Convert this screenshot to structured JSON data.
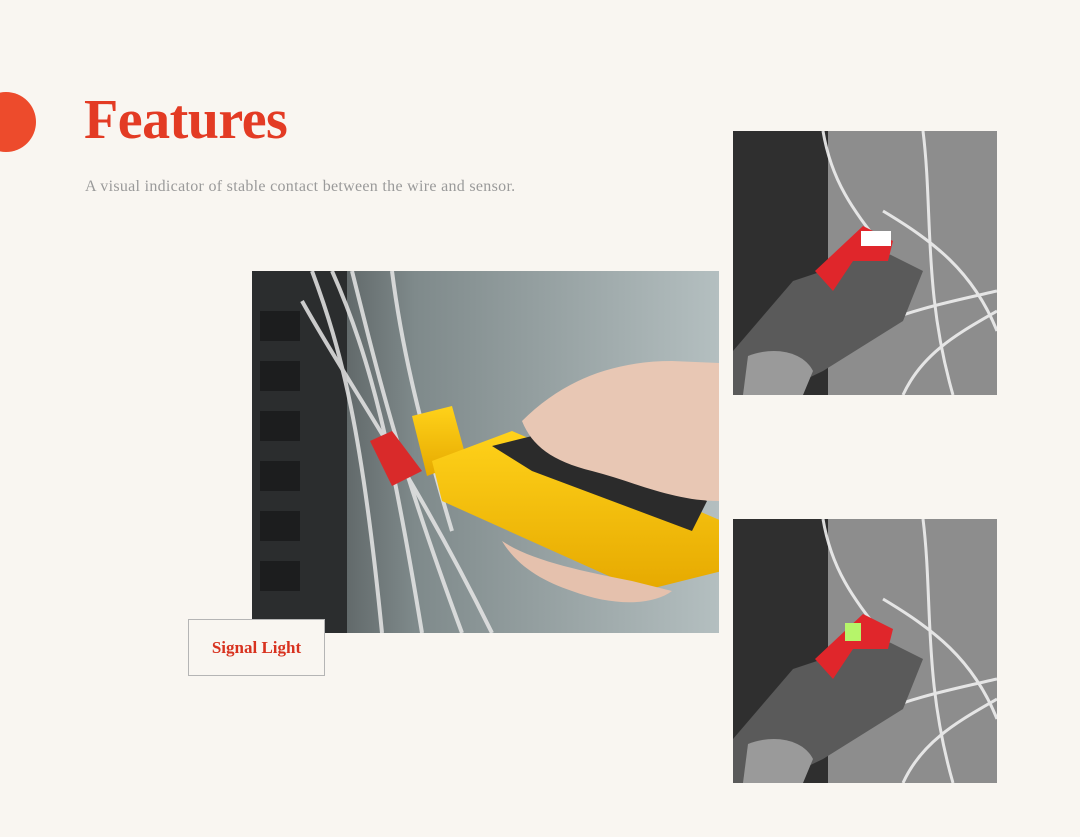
{
  "page": {
    "title": "Features",
    "subtitle": "A visual indicator of stable contact between the wire and sensor."
  },
  "callout": {
    "label": "Signal Light"
  },
  "colors": {
    "accent": "#e33b24",
    "dot": "#ed4b2c",
    "background": "#f9f6f1",
    "subtitle": "#9a9a9a"
  }
}
